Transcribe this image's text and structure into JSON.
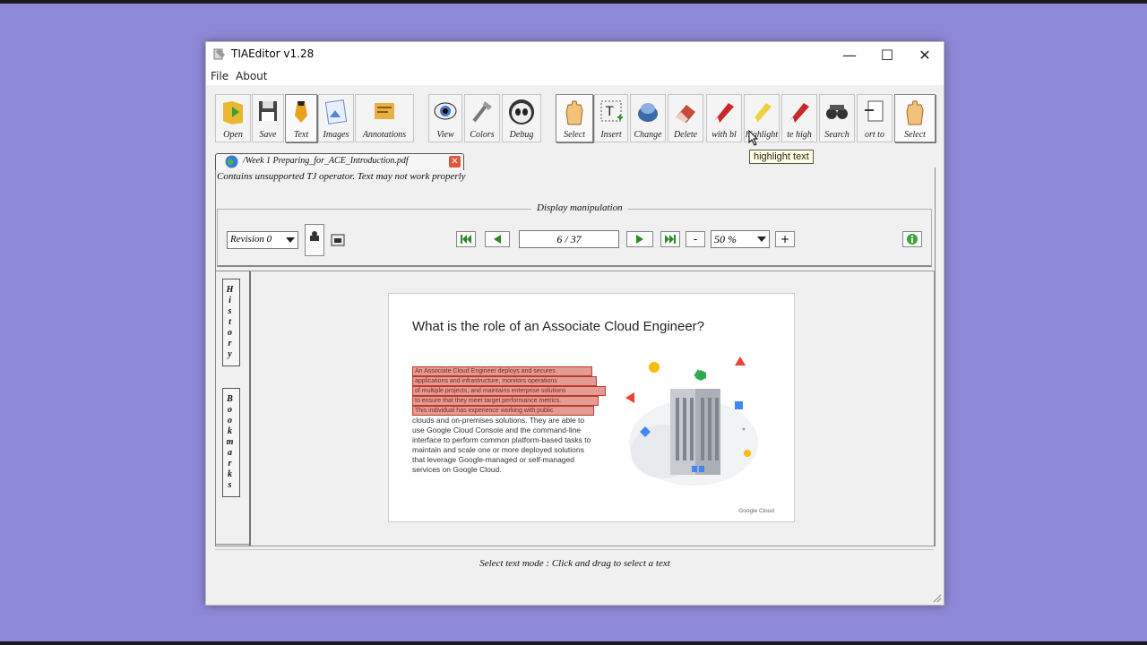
{
  "window": {
    "title": "TIAEditor v1.28",
    "minimize": "—",
    "maximize": "☐",
    "close": "✕"
  },
  "menu": {
    "file": "File",
    "about": "About"
  },
  "toolbar": [
    {
      "label": "Open",
      "icon": "open-folder-icon"
    },
    {
      "label": "Save",
      "icon": "floppy-disk-icon"
    },
    {
      "label": "Text",
      "icon": "pencil-icon"
    },
    {
      "label": "Images",
      "icon": "image-icon"
    },
    {
      "label": "Annotations",
      "icon": "notes-icon"
    },
    {
      "label": "View",
      "icon": "eye-icon"
    },
    {
      "label": "Colors",
      "icon": "tools-icon"
    },
    {
      "label": "Debug",
      "icon": "alien-icon"
    },
    {
      "label": "Select",
      "icon": "hand-icon"
    },
    {
      "label": "Insert",
      "icon": "insert-text-icon"
    },
    {
      "label": "Change",
      "icon": "change-icon"
    },
    {
      "label": "Delete",
      "icon": "eraser-icon"
    },
    {
      "label": "with bl",
      "icon": "marker-icon"
    },
    {
      "label": "highlight",
      "icon": "highlighter-icon"
    },
    {
      "label": "te high",
      "icon": "marker-icon"
    },
    {
      "label": "Search",
      "icon": "binoculars-icon"
    },
    {
      "label": "ort to",
      "icon": "export-icon"
    },
    {
      "label": "Select",
      "icon": "hand-icon"
    }
  ],
  "tooltip": "highlight text",
  "document_tab": {
    "name": "/Week 1 Preparing_for_ACE_Introduction.pdf",
    "close": "✕"
  },
  "warning": "Contains unsupported TJ operator. Text may not work properly",
  "display": {
    "group_title": "Display manipulation",
    "revision": "Revision 0",
    "page": "6 / 37",
    "zoom": "50 %",
    "zoom_out": "-",
    "zoom_in": "+"
  },
  "sidebar": {
    "history": "History",
    "bookmarks": "Bookmarks"
  },
  "slide": {
    "title": "What is the role of an Associate Cloud Engineer?",
    "highlighted_lines": [
      "An Associate Cloud Engineer deploys and secures",
      "applications and infrastructure, monitors operations",
      "of multiple projects, and maintains enterprise solutions",
      "to ensure that they meet target performance metrics.",
      "This individual has experience working with public"
    ],
    "body_lines": [
      "clouds and on-premises solutions. They are able to",
      "use Google Cloud Console and the command-line",
      "interface to perform common platform-based tasks to",
      "maintain and scale one or more deployed solutions",
      "that leverage Google-managed or self-managed",
      "services on Google Cloud."
    ],
    "logo": "Google Cloud"
  },
  "status": "Select text mode : Click and drag to select a text",
  "colors": {
    "background": "#8e88d8",
    "highlight_border": "#c0392b",
    "highlight_fill": "#e39c94"
  }
}
